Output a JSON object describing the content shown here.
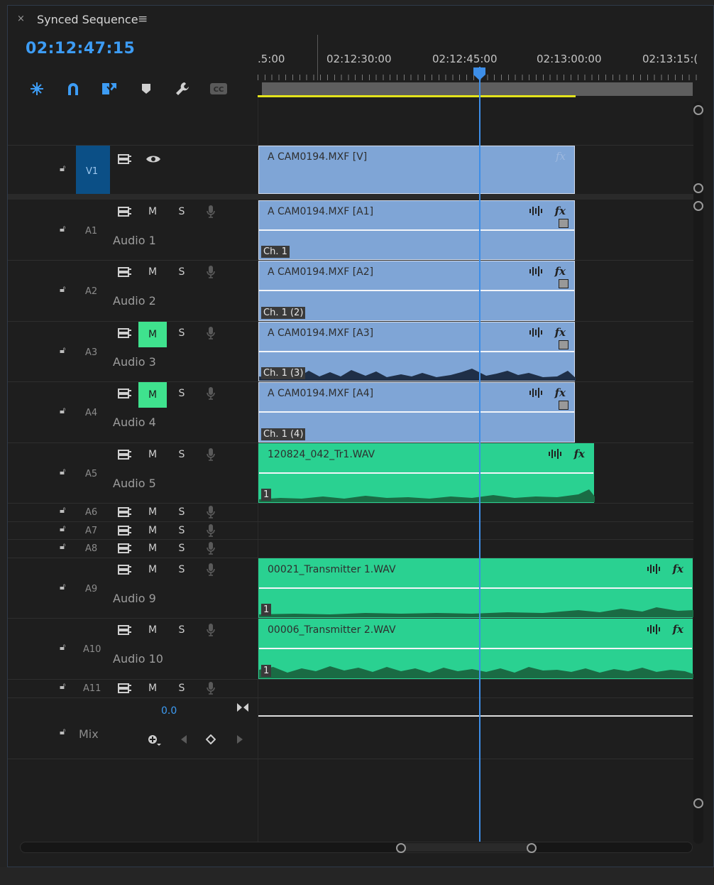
{
  "header": {
    "close": "×",
    "title": "Synced Sequence",
    "menu": "≡",
    "timecode": "02:12:47:15"
  },
  "ruler": [
    ".5:00",
    "02:12:30:00",
    "02:12:45:00",
    "02:13:00:00",
    "02:13:15:("
  ],
  "tracks": {
    "v1": {
      "label": "V1"
    },
    "audio": [
      {
        "id": "A1",
        "name": "Audio 1",
        "mute_on": false,
        "size": "large"
      },
      {
        "id": "A2",
        "name": "Audio 2",
        "mute_on": false,
        "size": "large"
      },
      {
        "id": "A3",
        "name": "Audio 3",
        "mute_on": true,
        "size": "large"
      },
      {
        "id": "A4",
        "name": "Audio 4",
        "mute_on": true,
        "size": "large"
      },
      {
        "id": "A5",
        "name": "Audio 5",
        "mute_on": false,
        "size": "large"
      },
      {
        "id": "A6",
        "name": "",
        "mute_on": false,
        "size": "small"
      },
      {
        "id": "A7",
        "name": "",
        "mute_on": false,
        "size": "small"
      },
      {
        "id": "A8",
        "name": "",
        "mute_on": false,
        "size": "small"
      },
      {
        "id": "A9",
        "name": "Audio 9",
        "mute_on": false,
        "size": "large"
      },
      {
        "id": "A10",
        "name": "Audio 10",
        "mute_on": false,
        "size": "large"
      },
      {
        "id": "A11",
        "name": "",
        "mute_on": false,
        "size": "small"
      }
    ],
    "mute_label": "M",
    "solo_label": "S"
  },
  "clips": {
    "fx": "fx",
    "v1": {
      "name": "A CAM0194.MXF [V]"
    },
    "a1": {
      "name": "A CAM0194.MXF [A1]",
      "channel": "Ch. 1"
    },
    "a2": {
      "name": "A CAM0194.MXF [A2]",
      "channel": "Ch. 1 (2)"
    },
    "a3": {
      "name": "A CAM0194.MXF [A3]",
      "channel": "Ch. 1 (3)"
    },
    "a4": {
      "name": "A CAM0194.MXF [A4]",
      "channel": "Ch. 1 (4)"
    },
    "a5": {
      "name": "120824_042_Tr1.WAV",
      "channel": "1"
    },
    "a9": {
      "name": "00021_Transmitter 1.WAV",
      "channel": "1"
    },
    "a10": {
      "name": "00006_Transmitter 2.WAV",
      "channel": "1"
    }
  },
  "mix": {
    "label": "Mix",
    "value": "0.0"
  },
  "colors": {
    "accent": "#3d9cf4",
    "video_clip": "#7fa5d6",
    "audio_clip_green": "#2ad191",
    "mute_on": "#3fe28e",
    "render_bar": "#e3e31c"
  }
}
